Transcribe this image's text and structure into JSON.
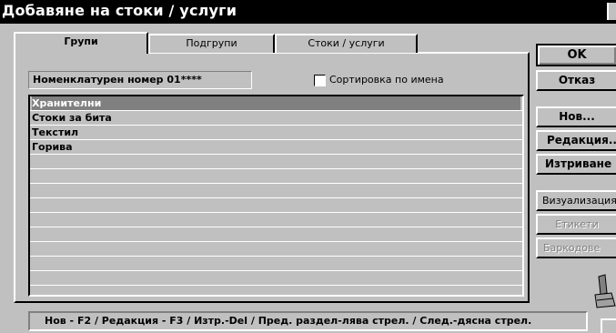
{
  "window": {
    "title": "Добавяне на стоки / услуги"
  },
  "tabs": [
    {
      "label": "Групи",
      "active": true
    },
    {
      "label": "Подгрупи",
      "active": false
    },
    {
      "label": "Стоки / услуги",
      "active": false
    }
  ],
  "nomenclature_label": "Номенклатурен номер 01****",
  "sort_checkbox": {
    "label": "Сортировка по имена",
    "checked": false
  },
  "list": {
    "items": [
      "Хранителни",
      "Стоки за бита",
      "Текстил",
      "Горива"
    ],
    "selected_index": 0
  },
  "buttons": {
    "ok": "OK",
    "cancel": "Отказ",
    "new": "Нов...",
    "edit": "Редакция...",
    "delete": "Изтриване",
    "visualization": "Визуализация",
    "labels": "Етикети",
    "barcodes": "Баркодове"
  },
  "status_bar": "Нов - F2 / Редакция - F3 / Изтр.-Del / Пред. раздел-лява стрел. / След.-дясна стрел.",
  "colors": {
    "titlebar": "#000000",
    "face": "#c0c0c0",
    "selection": "#808080"
  }
}
